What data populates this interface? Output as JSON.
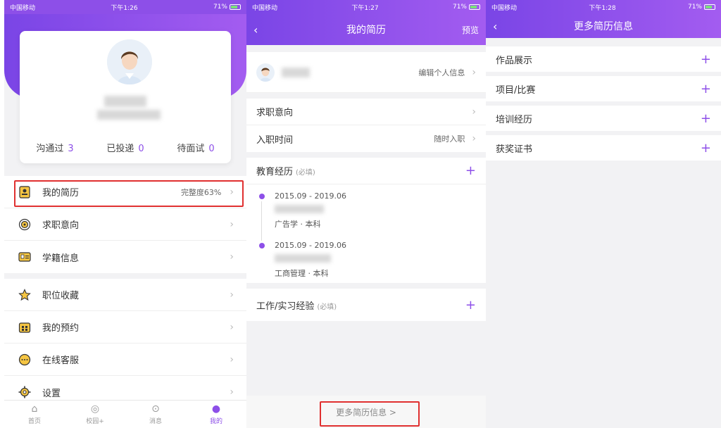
{
  "status": {
    "s1": {
      "carrier": "中国移动",
      "time": "下午1:26",
      "battery": "71%"
    },
    "s2": {
      "carrier": "中国移动",
      "time": "下午1:27",
      "battery": "71%"
    },
    "s3": {
      "carrier": "中国移动",
      "time": "下午1:28",
      "battery": "71%"
    }
  },
  "profile": {
    "stats": [
      {
        "label": "沟通过",
        "value": "3"
      },
      {
        "label": "已投递",
        "value": "0"
      },
      {
        "label": "待面试",
        "value": "0"
      }
    ],
    "menu": [
      {
        "label": "我的简历",
        "extra": "完整度63%",
        "icon": "resume-icon"
      },
      {
        "label": "求职意向",
        "extra": "",
        "icon": "target-icon"
      },
      {
        "label": "学籍信息",
        "extra": "",
        "icon": "id-card-icon"
      },
      {
        "label": "职位收藏",
        "extra": "",
        "icon": "star-icon"
      },
      {
        "label": "我的预约",
        "extra": "",
        "icon": "calendar-icon"
      },
      {
        "label": "在线客服",
        "extra": "",
        "icon": "chat-icon"
      },
      {
        "label": "设置",
        "extra": "",
        "icon": "gear-icon"
      }
    ],
    "tabs": [
      {
        "label": "首页",
        "icon": "home-icon"
      },
      {
        "label": "校园+",
        "icon": "eye-icon"
      },
      {
        "label": "消息",
        "icon": "message-icon"
      },
      {
        "label": "我的",
        "icon": "person-icon"
      }
    ]
  },
  "resume": {
    "title": "我的简历",
    "preview": "预览",
    "edit_profile": "编辑个人信息",
    "intent": "求职意向",
    "entry_time_label": "入职时间",
    "entry_time_value": "随时入职",
    "education": {
      "label": "教育经历",
      "required": "(必填)"
    },
    "edu_items": [
      {
        "date": "2015.09 - 2019.06",
        "degree": "广告学 · 本科"
      },
      {
        "date": "2015.09 - 2019.06",
        "degree": "工商管理 · 本科"
      }
    ],
    "work": {
      "label": "工作/实习经验",
      "required": "(必填)"
    },
    "more_link": "更多简历信息 >"
  },
  "more": {
    "title": "更多简历信息",
    "items": [
      "作品展示",
      "项目/比赛",
      "培训经历",
      "获奖证书"
    ]
  },
  "colors": {
    "accent": "#8d4fe8",
    "highlight": "#e03030"
  }
}
